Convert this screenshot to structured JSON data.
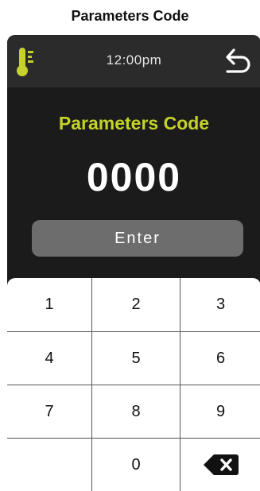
{
  "caption": "Parameters Code",
  "header": {
    "time": "12:00pm",
    "thermometer_icon": "thermometer-icon",
    "back_icon": "undo-arrow-icon"
  },
  "main": {
    "title": "Parameters Code",
    "code": "0000",
    "enter_label": "Enter"
  },
  "keypad": {
    "keys": [
      "1",
      "2",
      "3",
      "4",
      "5",
      "6",
      "7",
      "8",
      "9",
      "",
      "0",
      "⌫"
    ],
    "backspace_icon": "backspace-icon"
  },
  "colors": {
    "accent": "#C4D22B",
    "screen_bg": "#1B1B1B",
    "header_bg": "#2B2B2B",
    "button_bg": "#6D6D6D"
  }
}
